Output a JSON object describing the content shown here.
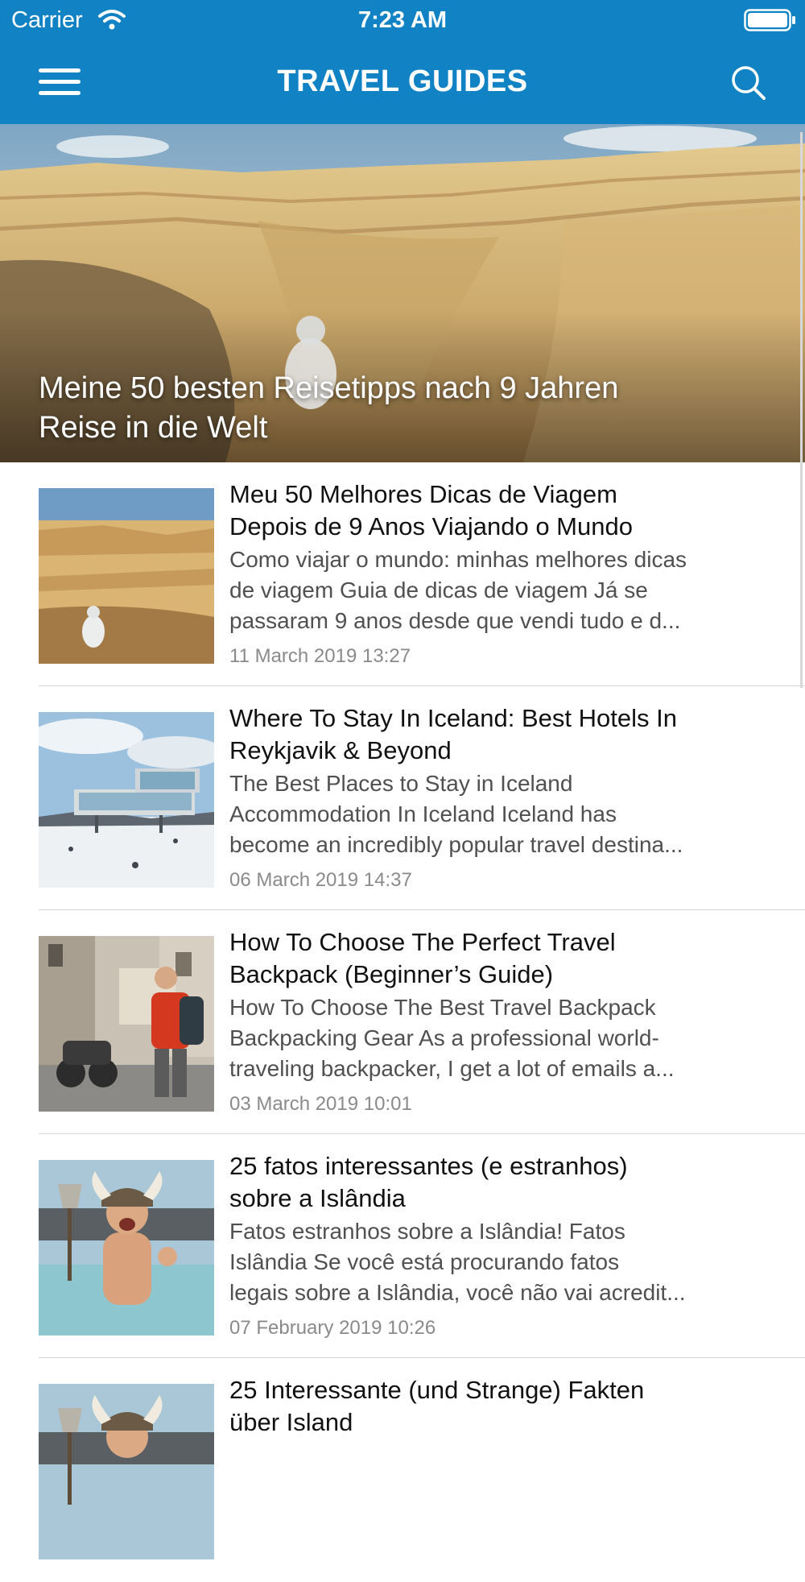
{
  "status_bar": {
    "carrier": "Carrier",
    "time": "7:23 AM",
    "wifi_icon": "wifi-icon",
    "battery_icon": "battery-icon"
  },
  "navbar": {
    "title": "TRAVEL GUIDES",
    "menu_icon": "hamburger-menu-icon",
    "search_icon": "search-icon",
    "background_color": "#1182c4"
  },
  "hero": {
    "title": "Meine 50 besten Reisetipps nach 9 Jahren\nReise in die Welt"
  },
  "articles": [
    {
      "title": "Meu 50 Melhores Dicas de Viagem\nDepois de 9 Anos Viajando o Mundo",
      "excerpt": "Como viajar o mundo: minhas melhores dicas\nde viagem   Guia de dicas de viagem  Já se\npassaram 9 anos desde que vendi tudo e d...",
      "date": "11 March 2019 13:27"
    },
    {
      "title": "Where To Stay In Iceland: Best Hotels In\nReykjavik & Beyond",
      "excerpt": "The Best Places to Stay in Iceland\nAccommodation In Iceland  Iceland has\nbecome an incredibly popular travel destina...",
      "date": "06 March 2019 14:37"
    },
    {
      "title": "How To Choose The Perfect Travel\nBackpack (Beginner’s Guide)",
      "excerpt": "How To Choose The Best Travel Backpack\nBackpacking Gear  As a professional world-\ntraveling backpacker, I get a lot of emails a...",
      "date": "03 March 2019 10:01"
    },
    {
      "title": "25 fatos interessantes (e estranhos)\nsobre a Islândia",
      "excerpt": "Fatos estranhos sobre a Islândia!   Fatos\nIslândia  Se você está procurando fatos\nlegais sobre a Islândia, você não vai acredit...",
      "date": "07 February 2019 10:26"
    },
    {
      "title": "25 Interessante (und Strange) Fakten\nüber Island",
      "excerpt": "",
      "date": ""
    }
  ]
}
